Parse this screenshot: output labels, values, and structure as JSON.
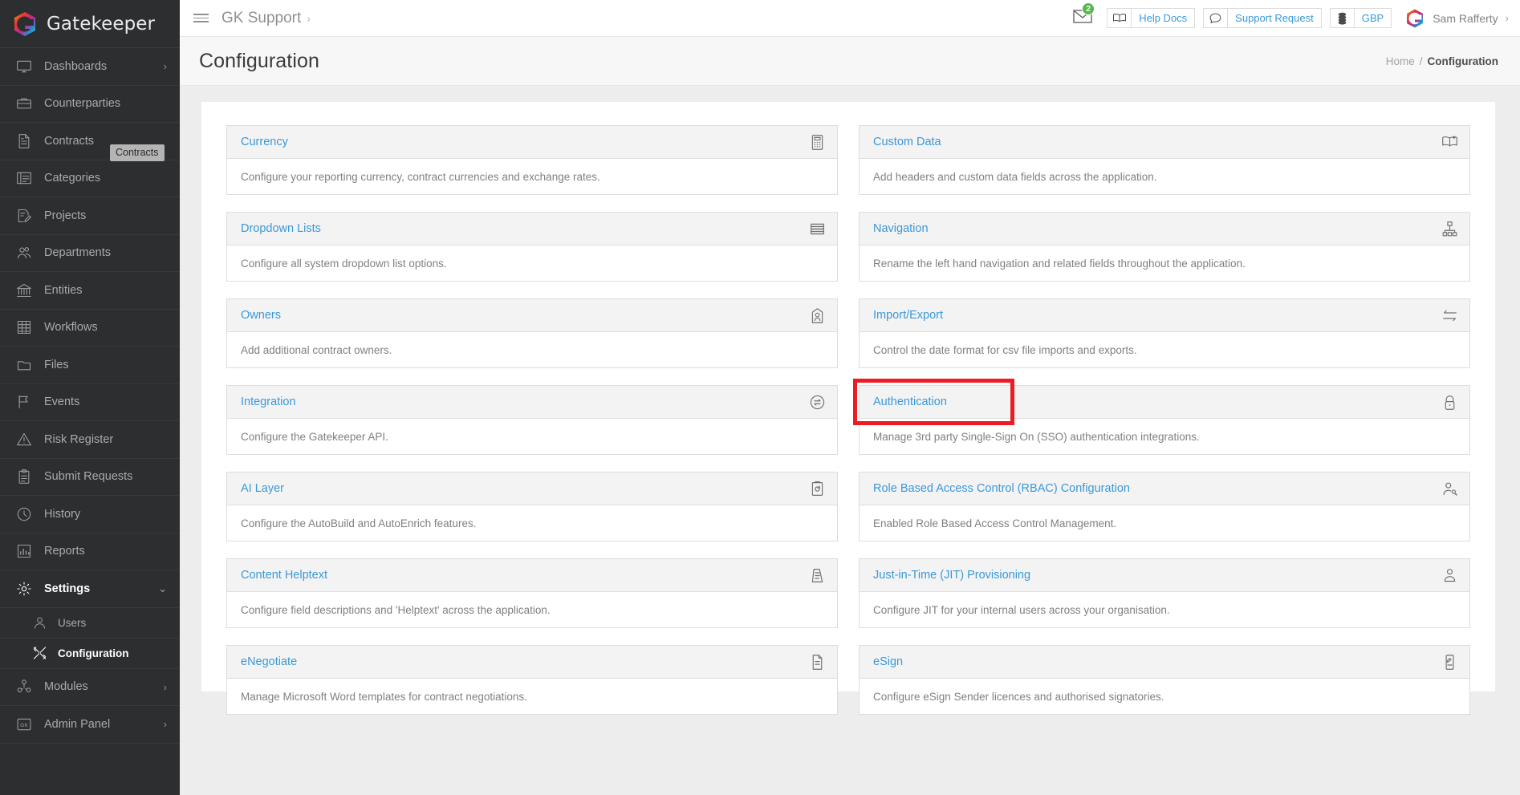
{
  "brand": {
    "name": "Gatekeeper",
    "logo_icon": "gatekeeper-logo-icon"
  },
  "sidebar": {
    "tooltip": "Contracts",
    "items": [
      {
        "label": "Dashboards",
        "icon": "monitor-icon",
        "chevron": "›"
      },
      {
        "label": "Counterparties",
        "icon": "briefcase-icon",
        "chevron": ""
      },
      {
        "label": "Contracts",
        "icon": "document-icon",
        "chevron": ""
      },
      {
        "label": "Categories",
        "icon": "folder-list-icon",
        "chevron": ""
      },
      {
        "label": "Projects",
        "icon": "document-edit-icon",
        "chevron": ""
      },
      {
        "label": "Departments",
        "icon": "people-icon",
        "chevron": ""
      },
      {
        "label": "Entities",
        "icon": "bank-icon",
        "chevron": ""
      },
      {
        "label": "Workflows",
        "icon": "grid-table-icon",
        "chevron": ""
      },
      {
        "label": "Files",
        "icon": "folder-icon",
        "chevron": ""
      },
      {
        "label": "Events",
        "icon": "flag-icon",
        "chevron": ""
      },
      {
        "label": "Risk Register",
        "icon": "warning-triangle-icon",
        "chevron": ""
      },
      {
        "label": "Submit Requests",
        "icon": "clipboard-icon",
        "chevron": ""
      },
      {
        "label": "History",
        "icon": "clock-icon",
        "chevron": ""
      },
      {
        "label": "Reports",
        "icon": "bar-chart-icon",
        "chevron": ""
      },
      {
        "label": "Settings",
        "icon": "gear-icon",
        "chevron": "⌄",
        "active": true
      }
    ],
    "sub_items": [
      {
        "label": "Users",
        "icon": "user-icon",
        "current": false
      },
      {
        "label": "Configuration",
        "icon": "tools-icon",
        "current": true
      }
    ],
    "items_after": [
      {
        "label": "Modules",
        "icon": "modules-icon",
        "chevron": "›"
      },
      {
        "label": "Admin Panel",
        "icon": "gk-badge-icon",
        "chevron": "›"
      }
    ]
  },
  "topbar": {
    "menu_icon": "hamburger-icon",
    "workspace": "GK Support",
    "workspace_caret": "›",
    "mail_icon": "envelope-icon",
    "mail_badge": "2",
    "buttons": [
      {
        "label": "Help Docs",
        "icon": "book-icon"
      },
      {
        "label": "Support Request",
        "icon": "chat-bubble-icon"
      },
      {
        "label": "GBP",
        "icon": "coins-icon"
      }
    ],
    "user": {
      "name": "Sam Rafferty",
      "avatar_icon": "gatekeeper-avatar-icon",
      "caret": "›"
    }
  },
  "page": {
    "title": "Configuration",
    "breadcrumb": {
      "home": "Home",
      "separator": "/",
      "current": "Configuration"
    }
  },
  "colors": {
    "link": "#3a99d9",
    "sidebar_bg": "#2c2e2f",
    "highlight": "#ed1c24",
    "badge_green": "#54b948"
  },
  "cards": {
    "left": [
      {
        "title": "Currency",
        "desc": "Configure your reporting currency, contract currencies and exchange rates.",
        "icon": "calculator-icon"
      },
      {
        "title": "Dropdown Lists",
        "desc": "Configure all system dropdown list options.",
        "icon": "list-lines-icon"
      },
      {
        "title": "Owners",
        "desc": "Add additional contract owners.",
        "icon": "owner-tag-icon"
      },
      {
        "title": "Integration",
        "desc": "Configure the Gatekeeper API.",
        "icon": "exchange-circle-icon"
      },
      {
        "title": "AI Layer",
        "desc": "Configure the AutoBuild and AutoEnrich features.",
        "icon": "ai-refresh-icon"
      },
      {
        "title": "Content Helptext",
        "desc": "Configure field descriptions and 'Helptext' across the application.",
        "icon": "helptext-doc-icon"
      },
      {
        "title": "eNegotiate",
        "desc": "Manage Microsoft Word templates for contract negotiations.",
        "icon": "doc-lines-icon"
      }
    ],
    "right": [
      {
        "title": "Custom Data",
        "desc": "Add headers and custom data fields across the application.",
        "icon": "open-book-plus-icon"
      },
      {
        "title": "Navigation",
        "desc": "Rename the left hand navigation and related fields throughout the application.",
        "icon": "sitemap-icon"
      },
      {
        "title": "Import/Export",
        "desc": "Control the date format for csv file imports and exports.",
        "icon": "arrows-lr-icon"
      },
      {
        "title": "Authentication",
        "desc": "Manage 3rd party Single-Sign On (SSO) authentication integrations.",
        "icon": "padlock-icon",
        "highlighted": true
      },
      {
        "title": "Role Based Access Control (RBAC) Configuration",
        "desc": "Enabled Role Based Access Control Management.",
        "icon": "user-key-icon"
      },
      {
        "title": "Just-in-Time (JIT) Provisioning",
        "desc": "Configure JIT for your internal users across your organisation.",
        "icon": "user-shield-icon"
      },
      {
        "title": "eSign",
        "desc": "Configure eSign Sender licences and authorised signatories.",
        "icon": "doc-pen-icon"
      }
    ]
  }
}
